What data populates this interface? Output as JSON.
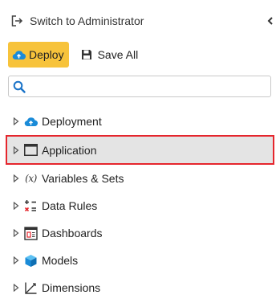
{
  "header": {
    "switch_label": "Switch to Administrator",
    "switch_icon": "exit-icon",
    "collapse_icon": "chevron-left-icon"
  },
  "toolbar": {
    "deploy_label": "Deploy",
    "deploy_icon": "cloud-upload-icon",
    "save_label": "Save All",
    "save_icon": "floppy-disk-icon",
    "accent_color": "#f7c33b"
  },
  "search": {
    "value": "",
    "placeholder": "",
    "icon": "search-icon"
  },
  "tree": {
    "selected_outline_color": "#e5262d",
    "items": [
      {
        "label": "Deployment",
        "icon": "cloud-upload-icon",
        "expanded": false,
        "selected": false
      },
      {
        "label": "Application",
        "icon": "window-icon",
        "expanded": false,
        "selected": true
      },
      {
        "label": "Variables & Sets",
        "icon": "variable-icon",
        "icon_text": "(x)",
        "expanded": false,
        "selected": false
      },
      {
        "label": "Data Rules",
        "icon": "data-rules-icon",
        "expanded": false,
        "selected": false
      },
      {
        "label": "Dashboards",
        "icon": "dashboard-icon",
        "expanded": false,
        "selected": false
      },
      {
        "label": "Models",
        "icon": "cube-icon",
        "expanded": false,
        "selected": false
      },
      {
        "label": "Dimensions",
        "icon": "axis-chart-icon",
        "expanded": false,
        "selected": false
      }
    ]
  }
}
